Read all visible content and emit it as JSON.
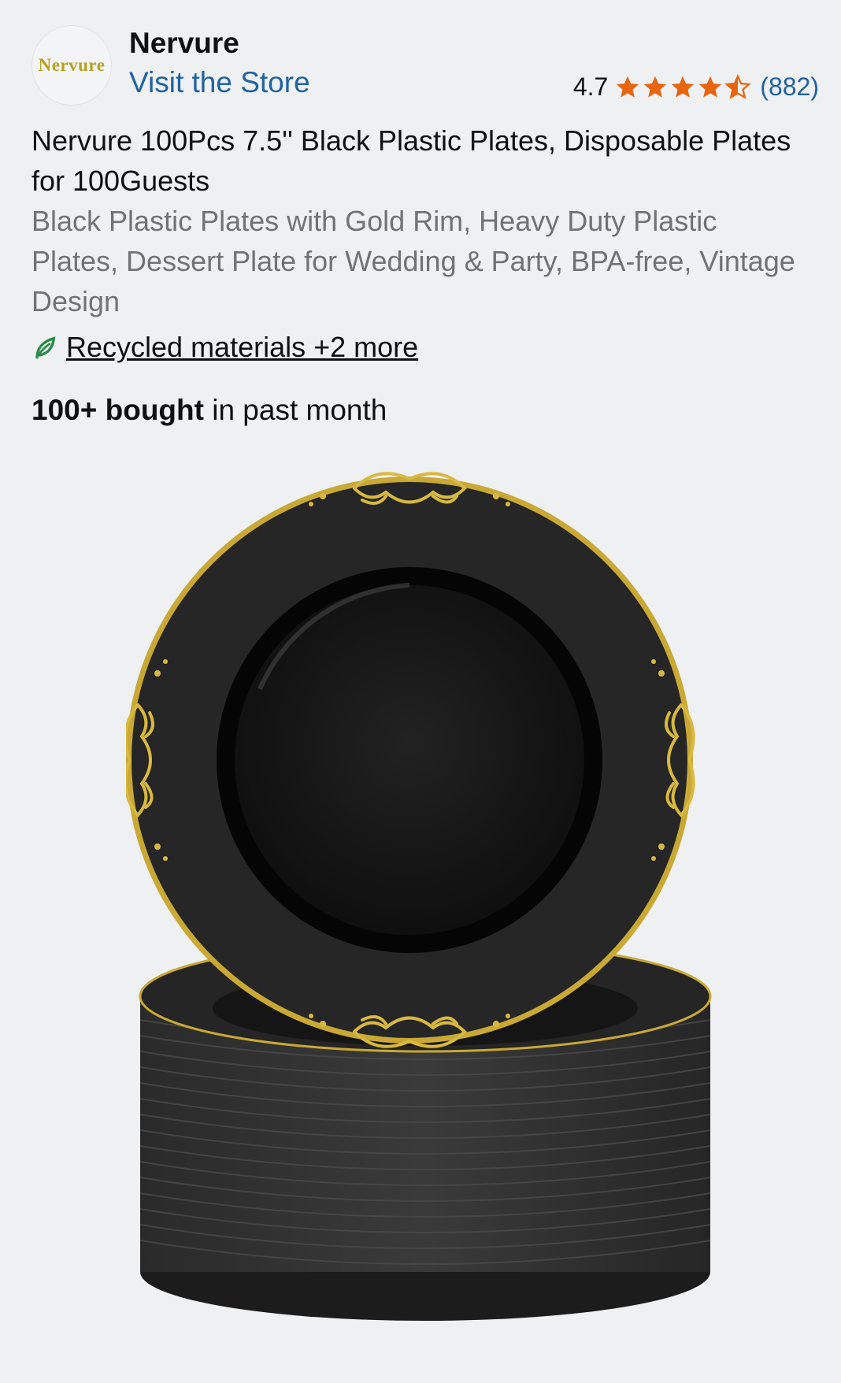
{
  "brand": {
    "logo_text": "Nervure",
    "name": "Nervure",
    "store_link": "Visit the Store"
  },
  "rating": {
    "value": "4.7",
    "stars": 4.5,
    "count": "(882)",
    "star_color": "#e8650f"
  },
  "product": {
    "title": "Nervure 100Pcs 7.5'' Black Plastic Plates, Disposable Plates for 100Guests",
    "subtitle": "Black Plastic Plates with Gold Rim, Heavy Duty Plastic Plates, Dessert Plate for Wedding & Party, BPA-free, Vintage Design",
    "badge_icon": "leaf-icon",
    "badge_text": "Recycled materials +2 more",
    "bought_bold": "100+ bought",
    "bought_rest": " in past month",
    "image_description_icon": "black-plates-with-gold-rim-image"
  },
  "colors": {
    "link": "#2162a1",
    "gold": "#c9a934",
    "plate": "#1a1a1a",
    "background": "#eef0f2"
  }
}
